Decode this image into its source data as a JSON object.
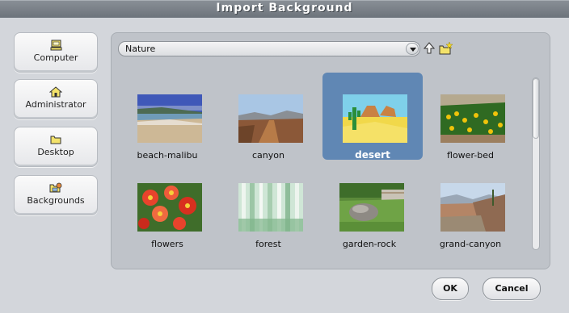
{
  "dialog": {
    "title": "Import Background"
  },
  "sidebar": {
    "items": [
      {
        "label": "Computer",
        "icon": "computer-icon"
      },
      {
        "label": "Administrator",
        "icon": "home-icon"
      },
      {
        "label": "Desktop",
        "icon": "folder-icon"
      },
      {
        "label": "Backgrounds",
        "icon": "backgrounds-folder-icon"
      }
    ]
  },
  "location": {
    "current": "Nature"
  },
  "files": [
    {
      "name": "beach-malibu",
      "selected": false
    },
    {
      "name": "canyon",
      "selected": false
    },
    {
      "name": "desert",
      "selected": true
    },
    {
      "name": "flower-bed",
      "selected": false
    },
    {
      "name": "flowers",
      "selected": false
    },
    {
      "name": "forest",
      "selected": false
    },
    {
      "name": "garden-rock",
      "selected": false
    },
    {
      "name": "grand-canyon",
      "selected": false
    }
  ],
  "buttons": {
    "ok": "OK",
    "cancel": "Cancel"
  },
  "colors": {
    "selection": "#6087b4",
    "title_bar": "#747b83",
    "panel": "#bfc3c9"
  }
}
